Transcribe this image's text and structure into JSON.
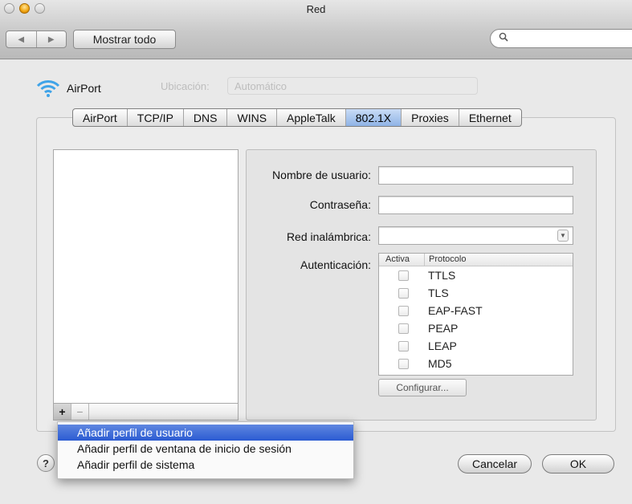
{
  "window": {
    "title": "Red"
  },
  "toolbar": {
    "show_all_label": "Mostrar todo",
    "search_placeholder": ""
  },
  "location": {
    "service_name": "AirPort",
    "faded_location_label": "Ubicación:",
    "faded_location_value": "Automático"
  },
  "tabs": [
    {
      "label": "AirPort",
      "active": false
    },
    {
      "label": "TCP/IP",
      "active": false
    },
    {
      "label": "DNS",
      "active": false
    },
    {
      "label": "WINS",
      "active": false
    },
    {
      "label": "AppleTalk",
      "active": false
    },
    {
      "label": "802.1X",
      "active": true
    },
    {
      "label": "Proxies",
      "active": false
    },
    {
      "label": "Ethernet",
      "active": false
    }
  ],
  "form": {
    "username_label": "Nombre de usuario:",
    "username_value": "",
    "password_label": "Contraseña:",
    "password_value": "",
    "wireless_label": "Red inalámbrica:",
    "wireless_value": "",
    "auth_label": "Autenticación:"
  },
  "auth_table": {
    "col_active": "Activa",
    "col_protocol": "Protocolo",
    "protocols": [
      {
        "name": "TTLS",
        "checked": false
      },
      {
        "name": "TLS",
        "checked": false
      },
      {
        "name": "EAP-FAST",
        "checked": false
      },
      {
        "name": "PEAP",
        "checked": false
      },
      {
        "name": "LEAP",
        "checked": false
      },
      {
        "name": "MD5",
        "checked": false
      }
    ]
  },
  "configure_label": "Configurar...",
  "list_controls": {
    "add": "+",
    "remove": "−"
  },
  "menu": [
    {
      "label": "Añadir perfil de usuario",
      "selected": true
    },
    {
      "label": "Añadir perfil de ventana de inicio de sesión",
      "selected": false
    },
    {
      "label": "Añadir perfil de sistema",
      "selected": false
    }
  ],
  "buttons": {
    "help": "?",
    "cancel": "Cancelar",
    "ok": "OK"
  },
  "colors": {
    "selection": "#3a68d8",
    "active_tab": "#a9c6ee"
  }
}
